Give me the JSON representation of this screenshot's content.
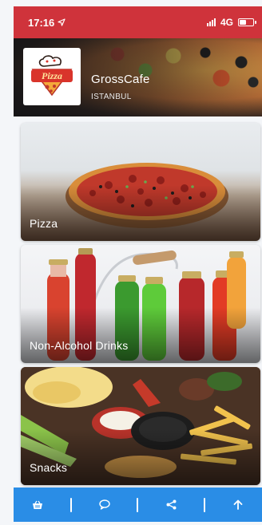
{
  "status_bar": {
    "time": "17:16",
    "network": "4G",
    "battery_level": 0.55,
    "icons": [
      "location-arrow-icon",
      "signal-icon",
      "battery-icon"
    ]
  },
  "header": {
    "cafe_name": "GrossCafe",
    "city": "ISTANBUL",
    "logo_text": "Pizza"
  },
  "categories": [
    {
      "label": "Pizza"
    },
    {
      "label": "Non-Alcohol Drinks"
    },
    {
      "label": "Snacks"
    }
  ],
  "bottom_bar": {
    "items": [
      "basket-icon",
      "chat-icon",
      "share-icon",
      "arrow-up-icon"
    ]
  },
  "colors": {
    "status_bar": "#cf333b",
    "bottom_bar": "#2a8de6"
  }
}
